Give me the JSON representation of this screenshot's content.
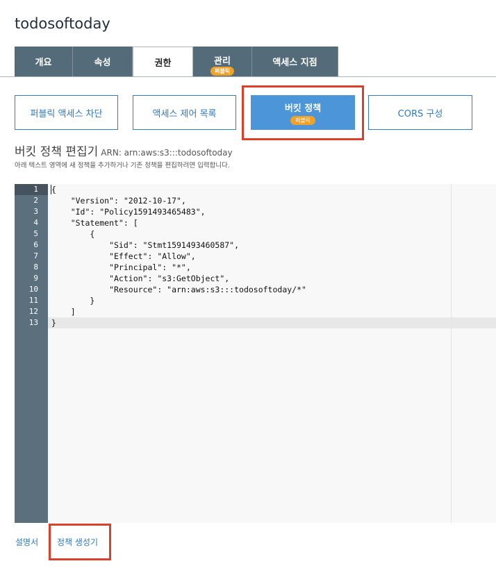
{
  "bucket_name": "todosoftoday",
  "tabs": [
    {
      "label": "개요"
    },
    {
      "label": "속성"
    },
    {
      "label": "권한"
    },
    {
      "label": "관리",
      "badge": "퍼블릭"
    },
    {
      "label": "액세스 지점"
    }
  ],
  "subtabs": [
    {
      "label": "퍼블릭 액세스 차단"
    },
    {
      "label": "액세스 제어 목록"
    },
    {
      "label": "버킷 정책",
      "badge": "퍼블릭"
    },
    {
      "label": "CORS 구성"
    }
  ],
  "editor": {
    "title": "버킷 정책 편집기",
    "arn": "ARN: arn:aws:s3:::todosoftoday",
    "description": "아래 텍스트 영역에 새 정책을 추가하거나 기존 정책을 편집하려면 입력합니다.",
    "line_numbers": [
      "1",
      "2",
      "3",
      "4",
      "5",
      "6",
      "7",
      "8",
      "9",
      "10",
      "11",
      "12",
      "13"
    ],
    "lines": [
      "{",
      "    \"Version\": \"2012-10-17\",",
      "    \"Id\": \"Policy1591493465483\",",
      "    \"Statement\": [",
      "        {",
      "            \"Sid\": \"Stmt1591493460587\",",
      "            \"Effect\": \"Allow\",",
      "            \"Principal\": \"*\",",
      "            \"Action\": \"s3:GetObject\",",
      "            \"Resource\": \"arn:aws:s3:::todosoftoday/*\"",
      "        }",
      "    ]",
      "}"
    ]
  },
  "footer": {
    "docs_link": "설명서",
    "policy_generator_link": "정책 생성기"
  },
  "colors": {
    "tab_bg": "#546b7a",
    "accent_blue": "#2f7ac0",
    "active_button": "#4c95d8",
    "badge_orange": "#f0a129",
    "highlight_red": "#d9412a"
  }
}
